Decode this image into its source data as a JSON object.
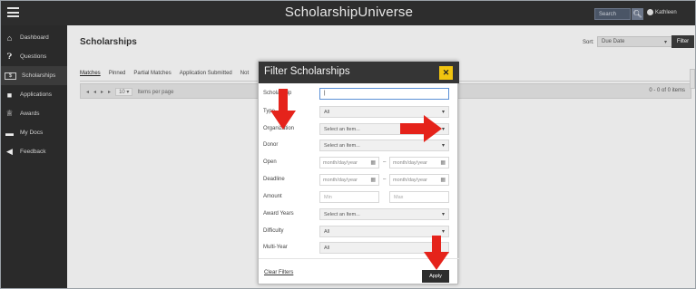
{
  "app": {
    "title": "ScholarshipUniverse"
  },
  "header": {
    "search_placeholder": "Search",
    "user_name": "Kathleen"
  },
  "sidebar": {
    "items": [
      {
        "label": "Dashboard",
        "icon": "home-icon"
      },
      {
        "label": "Questions",
        "icon": "question-icon"
      },
      {
        "label": "Scholarships",
        "icon": "scholarship-icon",
        "active": true
      },
      {
        "label": "Applications",
        "icon": "document-icon"
      },
      {
        "label": "Awards",
        "icon": "trophy-icon"
      },
      {
        "label": "My Docs",
        "icon": "folder-icon"
      },
      {
        "label": "Feedback",
        "icon": "megaphone-icon"
      }
    ]
  },
  "main": {
    "title": "Scholarships",
    "sort_label": "Sort:",
    "sort_value": "Due Date",
    "filter_button": "Filter",
    "tabs": [
      "Matches",
      "Pinned",
      "Partial Matches",
      "Application Submitted",
      "Not"
    ],
    "pager": {
      "per_page_value": "10",
      "per_page_label": "Items per page",
      "count": "0 - 0 of 0 items"
    }
  },
  "modal": {
    "title": "Filter Scholarships",
    "close": "✕",
    "fields": {
      "scholarship_label": "Scholarship",
      "type_label": "Type",
      "type_value": "All",
      "organization_label": "Organization",
      "organization_value": "Select an Item...",
      "donor_label": "Donor",
      "donor_value": "Select an Item...",
      "open_label": "Open",
      "deadline_label": "Deadline",
      "date_placeholder": "month/day/year",
      "amount_label": "Amount",
      "min_placeholder": "Min",
      "max_placeholder": "Max",
      "award_years_label": "Award Years",
      "award_years_value": "Select an Item...",
      "difficulty_label": "Difficulty",
      "difficulty_value": "All",
      "multi_year_label": "Multi-Year",
      "multi_year_value": "All"
    },
    "clear_filters": "Clear Filters",
    "apply": "Apply"
  },
  "colors": {
    "topbar": "#2d2d2d",
    "sidebar": "#2a2a2a",
    "close_button": "#f1c40f",
    "arrow": "#e5231b"
  }
}
